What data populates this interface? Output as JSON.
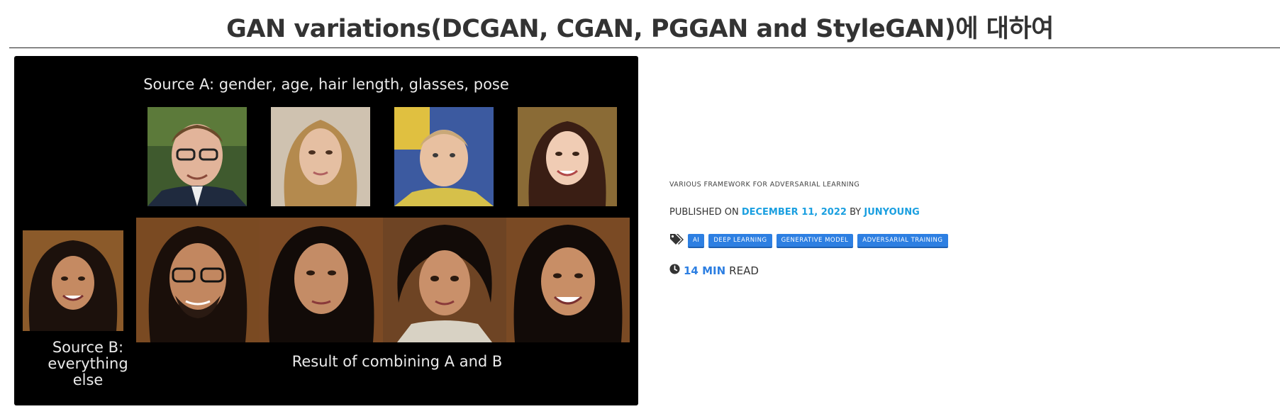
{
  "post": {
    "title": "GAN variations(DCGAN, CGAN, PGGAN and StyleGAN)에 대하여",
    "subtitle": "VARIOUS FRAMEWORK FOR ADVERSARIAL LEARNING",
    "published_prefix": "PUBLISHED ON",
    "date": "DECEMBER 11, 2022",
    "by": "BY",
    "author": "JUNYOUNG",
    "tags": [
      "AI",
      "DEEP LEARNING",
      "GENERATIVE MODEL",
      "ADVERSARIAL TRAINING"
    ],
    "read_time_num": "14 MIN",
    "read_time_label": "READ"
  },
  "hero": {
    "caption_a": "Source A: gender, age, hair length, glasses, pose",
    "caption_b_lines": [
      "Source B:",
      "everything",
      "else"
    ],
    "caption_result": "Result of combining A and B"
  },
  "colors": {
    "link": "#1a9fe0",
    "tag_bg": "#2d7fe2",
    "accent": "#2d7fe2"
  },
  "icons": [
    "tags-icon",
    "clock-icon"
  ]
}
